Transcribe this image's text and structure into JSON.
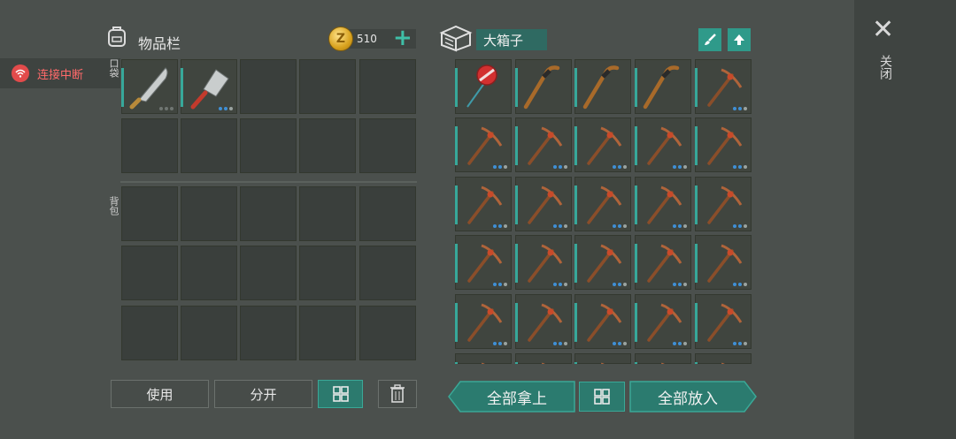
{
  "status": {
    "connection_label": "连接中断",
    "color": "#e24b4b"
  },
  "inventory": {
    "title": "物品栏",
    "icon": "backpack-icon",
    "coins": "510",
    "pocket_label": "口袋",
    "backpack_label": "背包",
    "pocket_items": [
      "machete",
      "cleaver"
    ]
  },
  "chest": {
    "icon": "chest-icon",
    "name": "大箱子",
    "items": [
      "bloodbag-fishing-rod",
      "hockey-stick",
      "hockey-stick",
      "hockey-stick",
      "pickaxe",
      "pickaxe",
      "pickaxe",
      "pickaxe",
      "pickaxe",
      "pickaxe",
      "pickaxe",
      "pickaxe",
      "pickaxe",
      "pickaxe",
      "pickaxe",
      "pickaxe",
      "pickaxe",
      "pickaxe",
      "pickaxe",
      "pickaxe",
      "pickaxe",
      "pickaxe",
      "pickaxe",
      "pickaxe",
      "pickaxe"
    ]
  },
  "buttons": {
    "use": "使用",
    "split": "分开",
    "take_all": "全部拿上",
    "put_all": "全部放入"
  },
  "close_label": "关闭",
  "accent": "#2c7a6e"
}
